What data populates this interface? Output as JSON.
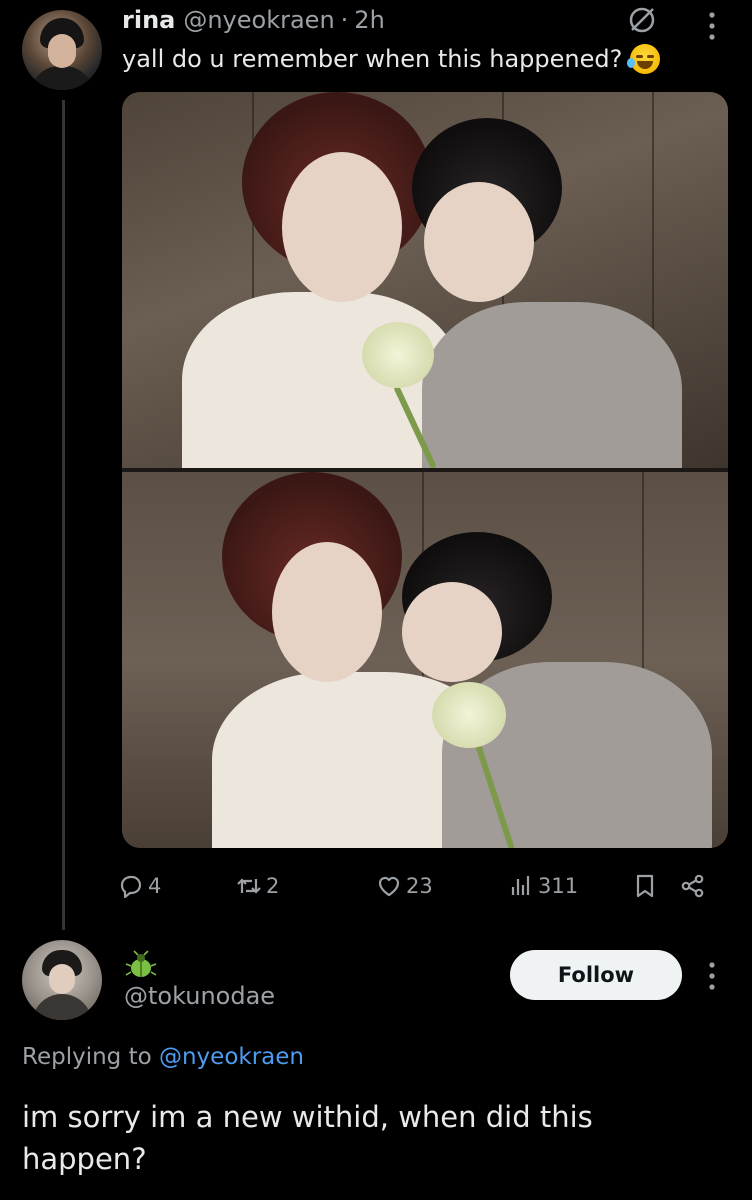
{
  "tweet": {
    "display_name": "rina",
    "handle": "@nyeokraen",
    "separator": "·",
    "time": "2h",
    "text": "yall do u remember when this happened?",
    "emoji": "face-with-tears-of-joy",
    "actions": {
      "replies": "4",
      "retweets": "2",
      "likes": "23",
      "views": "311"
    }
  },
  "reply": {
    "badge_icon": "bug-icon",
    "handle": "@tokunodae",
    "follow_label": "Follow",
    "replying_prefix": "Replying to ",
    "replying_mention": "@nyeokraen",
    "text": "im sorry im a new withid, when did this happen?"
  },
  "colors": {
    "background": "#000000",
    "text": "#e7e9ea",
    "muted": "#9ca1a6",
    "mention": "#4e9cf0",
    "follow_bg": "#eff3f4",
    "badge": "#7cc043"
  }
}
